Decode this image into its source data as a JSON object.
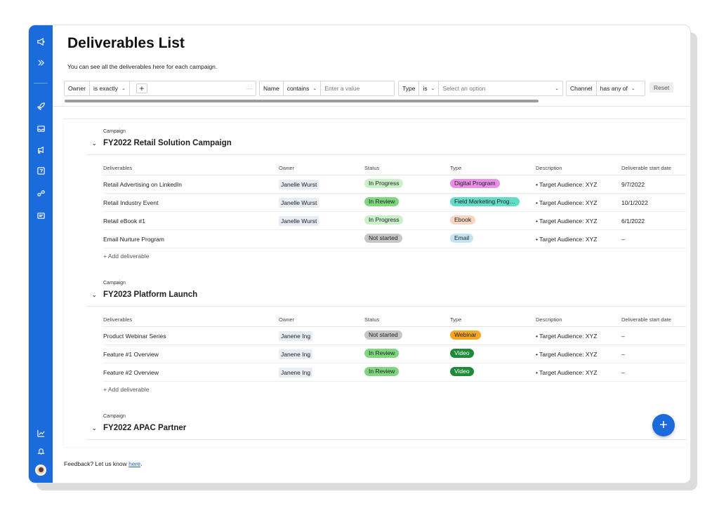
{
  "page": {
    "title": "Deliverables List",
    "subtitle": "You can see all the deliverables here for each campaign."
  },
  "filters": {
    "owner": {
      "label": "Owner",
      "operator": "is exactly",
      "more": "···"
    },
    "name": {
      "label": "Name",
      "operator": "contains",
      "placeholder": "Enter a value"
    },
    "type": {
      "label": "Type",
      "operator": "is",
      "placeholder": "Select an option"
    },
    "channel": {
      "label": "Channel",
      "operator": "has any of"
    },
    "reset_label": "Reset"
  },
  "columns": [
    "Deliverables",
    "Owner",
    "Status",
    "Type",
    "Description",
    "Deliverable start date"
  ],
  "campaigns": [
    {
      "label": "Campaign",
      "name": "FY2022 Retail Solution Campaign",
      "rows": [
        {
          "name": "Retail Advertising on LinkedIn",
          "owner": "Janelle Wurst",
          "status": "In Progress",
          "type": "Digital Program",
          "description": "• Target Audience: XYZ",
          "start": "9/7/2022"
        },
        {
          "name": "Retail Industry Event",
          "owner": "Janelle Wurst",
          "status": "In Review",
          "type": "Field Marketing Prog…",
          "description": "• Target Audience: XYZ",
          "start": "10/1/2022"
        },
        {
          "name": "Retail eBook #1",
          "owner": "Janelle Wurst",
          "status": "In Progress",
          "type": "Ebook",
          "description": "• Target Audience: XYZ",
          "start": "6/1/2022"
        },
        {
          "name": "Email Nurture Program",
          "owner": "",
          "status": "Not started",
          "type": "Email",
          "description": "• Target Audience: XYZ",
          "start": "–"
        }
      ],
      "add_label": "+ Add deliverable"
    },
    {
      "label": "Campaign",
      "name": "FY2023 Platform Launch",
      "rows": [
        {
          "name": "Product Webinar Series",
          "owner": "Janene Ing",
          "status": "Not started",
          "type": "Webinar",
          "description": "• Target Audience: XYZ",
          "start": "–"
        },
        {
          "name": "Feature #1 Overview",
          "owner": "Janene Ing",
          "status": "In Review",
          "type": "Video",
          "description": "• Target Audience: XYZ",
          "start": "–"
        },
        {
          "name": "Feature #2 Overview",
          "owner": "Janene Ing",
          "status": "In Review",
          "type": "Video",
          "description": "• Target Audience: XYZ",
          "start": "–"
        }
      ],
      "add_label": "+ Add deliverable"
    },
    {
      "label": "Campaign",
      "name": "FY2022 APAC Partner"
    }
  ],
  "pill_colors": {
    "In Progress": "#c9f0c9",
    "In Review": "#7fd67f",
    "Not started": "#c6c6c6",
    "Digital Program": "#ea8ee8",
    "Field Marketing Prog…": "#62dcc6",
    "Ebook": "#f9d6c4",
    "Email": "#c4e4f6",
    "Webinar": "#f5a623",
    "Video": "#1e8a3a"
  },
  "pill_text_colors": {
    "Video": "#ffffff"
  },
  "feedback": {
    "text": "Feedback? Let us know ",
    "link": "here",
    "suffix": "."
  },
  "fab_label": "+",
  "icons": {
    "rail": [
      "megaphone-icon",
      "expand-icon",
      "rocket-icon",
      "inbox-icon",
      "campaign-icon",
      "calendar-icon",
      "integrations-icon",
      "board-icon",
      "analytics-icon",
      "bell-icon",
      "avatar"
    ]
  }
}
